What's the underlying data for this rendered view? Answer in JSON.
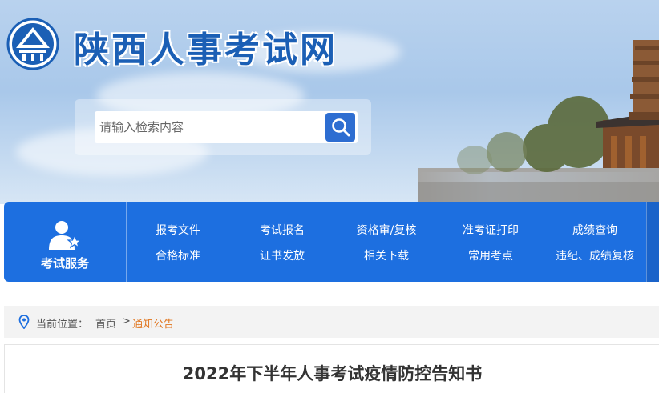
{
  "header": {
    "site_title": "陕西人事考试网"
  },
  "search": {
    "placeholder": "请输入检索内容"
  },
  "nav": {
    "service_label": "考试服务",
    "links_row1": [
      "报考文件",
      "考试报名",
      "资格审/复核",
      "准考证打印",
      "成绩查询"
    ],
    "links_row2": [
      "合格标准",
      "证书发放",
      "相关下载",
      "常用考点",
      "违纪、成绩复核"
    ]
  },
  "breadcrumb": {
    "label": "当前位置：",
    "home": "首页",
    "separator": ">",
    "current": "通知公告"
  },
  "article": {
    "title": "2022年下半年人事考试疫情防控告知书"
  },
  "colors": {
    "brand_blue": "#1d6fe0",
    "title_blue": "#1b5fb5",
    "breadcrumb_current": "#e0731a"
  }
}
